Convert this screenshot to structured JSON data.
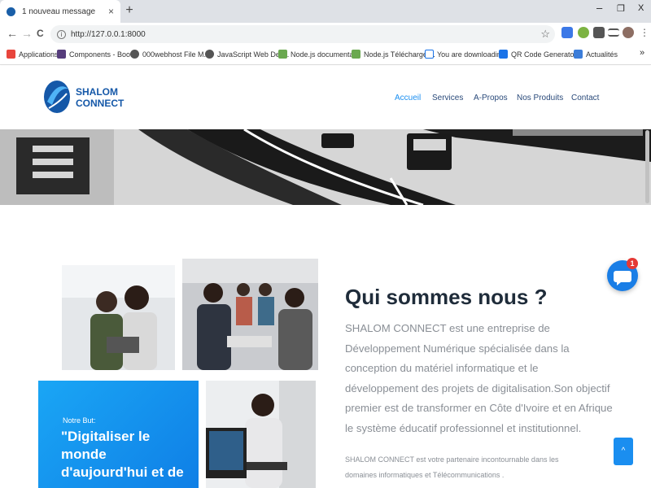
{
  "browser": {
    "tab_title": "1 nouveau message",
    "tab_close": "×",
    "new_tab": "+",
    "window_controls": {
      "minimize": "–",
      "restore": "❐",
      "close": "X"
    },
    "nav": {
      "back": "←",
      "forward": "→",
      "reload": "C"
    },
    "url": "http://127.0.0.1:8000",
    "info_glyph": "i",
    "star_glyph": "☆",
    "bookmarks": [
      {
        "label": "Applications",
        "icon": "apps-grid-icon",
        "color": "#e8453c"
      },
      {
        "label": "Components - Boot...",
        "icon": "bootstrap-icon",
        "color": "#563d7c"
      },
      {
        "label": "000webhost File M...",
        "icon": "globe-icon",
        "color": "#555555"
      },
      {
        "label": "JavaScript Web Dev...",
        "icon": "globe-icon",
        "color": "#555555"
      },
      {
        "label": "Node.js documenta...",
        "icon": "nodejs-icon",
        "color": "#6aa84f"
      },
      {
        "label": "Node.js Télécharger...",
        "icon": "nodejs-icon",
        "color": "#6aa84f"
      },
      {
        "label": "You are downloadin...",
        "icon": "page-icon",
        "color": "#1a73e8"
      },
      {
        "label": "QR Code Generator...",
        "icon": "qr-icon",
        "color": "#1a73e8"
      },
      {
        "label": "Actualités",
        "icon": "news-icon",
        "color": "#3c7dd9"
      }
    ],
    "bookmarks_more": "»"
  },
  "site": {
    "logo_line1": "SHALOM",
    "logo_line2": "CONNECT",
    "brand_color": "#1558a8",
    "accent_color": "#1a8ef0",
    "nav": [
      {
        "label": "Accueil",
        "active": true
      },
      {
        "label": "Services",
        "active": false
      },
      {
        "label": "A-Propos",
        "active": false
      },
      {
        "label": "Nos Produits",
        "active": false
      },
      {
        "label": "Contact",
        "active": false
      }
    ]
  },
  "about": {
    "title": "Qui sommes nous ?",
    "paragraph1": "SHALOM CONNECT est une entreprise de Développement Numérique spécialisée dans la conception du matériel informatique et le développement des projets de digitalisation.Son objectif premier est de transformer en Côte d'Ivoire et en Afrique le système éducatif professionnel et institutionnel.",
    "paragraph2": "SHALOM CONNECT est votre partenaire incontournable dans les domaines informatiques et Télécommunications ."
  },
  "goal": {
    "label": "Notre But:",
    "text": "\"Digitaliser le monde d'aujourd'hui et de"
  },
  "chat": {
    "badge": "1"
  },
  "back_to_top": "^"
}
